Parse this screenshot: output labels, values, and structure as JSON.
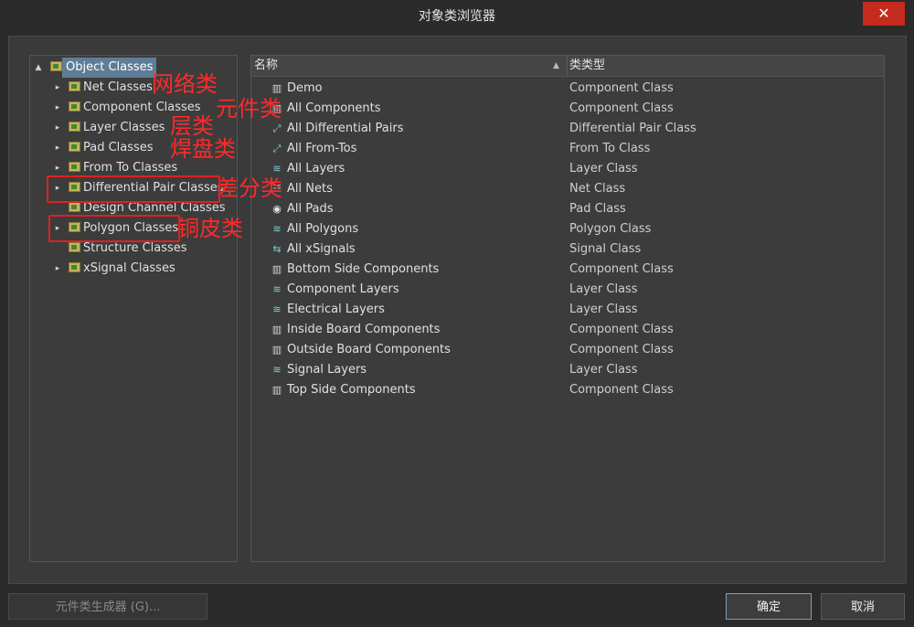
{
  "window": {
    "title": "对象类浏览器",
    "close_label": "✕"
  },
  "tree": {
    "root": {
      "label": "Object Classes",
      "expanded": true
    },
    "items": [
      {
        "label": "Net Classes",
        "has_children": true
      },
      {
        "label": "Component Classes",
        "has_children": true
      },
      {
        "label": "Layer Classes",
        "has_children": true
      },
      {
        "label": "Pad Classes",
        "has_children": true
      },
      {
        "label": "From To Classes",
        "has_children": true
      },
      {
        "label": "Differential Pair Classes",
        "has_children": true
      },
      {
        "label": "Design Channel Classes",
        "has_children": false
      },
      {
        "label": "Polygon Classes",
        "has_children": true
      },
      {
        "label": "Structure Classes",
        "has_children": false
      },
      {
        "label": "xSignal Classes",
        "has_children": true
      }
    ]
  },
  "list": {
    "columns": {
      "name": "名称",
      "type": "类类型"
    },
    "rows": [
      {
        "name": "Demo",
        "type": "Component Class",
        "icon": "component-icon"
      },
      {
        "name": "All Components",
        "type": "Component Class",
        "icon": "component-icon"
      },
      {
        "name": "All Differential Pairs",
        "type": "Differential Pair Class",
        "icon": "diff-pair-icon"
      },
      {
        "name": "All From-Tos",
        "type": "From To Class",
        "icon": "from-to-icon"
      },
      {
        "name": "All Layers",
        "type": "Layer Class",
        "icon": "layer-icon"
      },
      {
        "name": "All Nets",
        "type": "Net Class",
        "icon": "net-icon"
      },
      {
        "name": "All Pads",
        "type": "Pad Class",
        "icon": "pad-icon"
      },
      {
        "name": "All Polygons",
        "type": "Polygon Class",
        "icon": "polygon-icon"
      },
      {
        "name": "All xSignals",
        "type": "Signal Class",
        "icon": "xsignal-icon"
      },
      {
        "name": "Bottom Side Components",
        "type": "Component Class",
        "icon": "component-icon"
      },
      {
        "name": "Component Layers",
        "type": "Layer Class",
        "icon": "layer-icon"
      },
      {
        "name": "Electrical Layers",
        "type": "Layer Class",
        "icon": "layer-icon"
      },
      {
        "name": "Inside Board Components",
        "type": "Component Class",
        "icon": "component-icon"
      },
      {
        "name": "Outside Board Components",
        "type": "Component Class",
        "icon": "component-icon"
      },
      {
        "name": "Signal Layers",
        "type": "Layer Class",
        "icon": "layer-icon"
      },
      {
        "name": "Top Side Components",
        "type": "Component Class",
        "icon": "component-icon"
      }
    ]
  },
  "annotations": {
    "net": "网络类",
    "component": "元件类",
    "layer": "层类",
    "pad": "焊盘类",
    "diff_pair": "差分类",
    "polygon": "铜皮类"
  },
  "buttons": {
    "generator": "元件类生成器 (G)...",
    "ok": "确定",
    "cancel": "取消"
  },
  "colors": {
    "annotation_red": "#ff2a2a",
    "selection": "#5f7d96",
    "close_red": "#c42b1c"
  }
}
